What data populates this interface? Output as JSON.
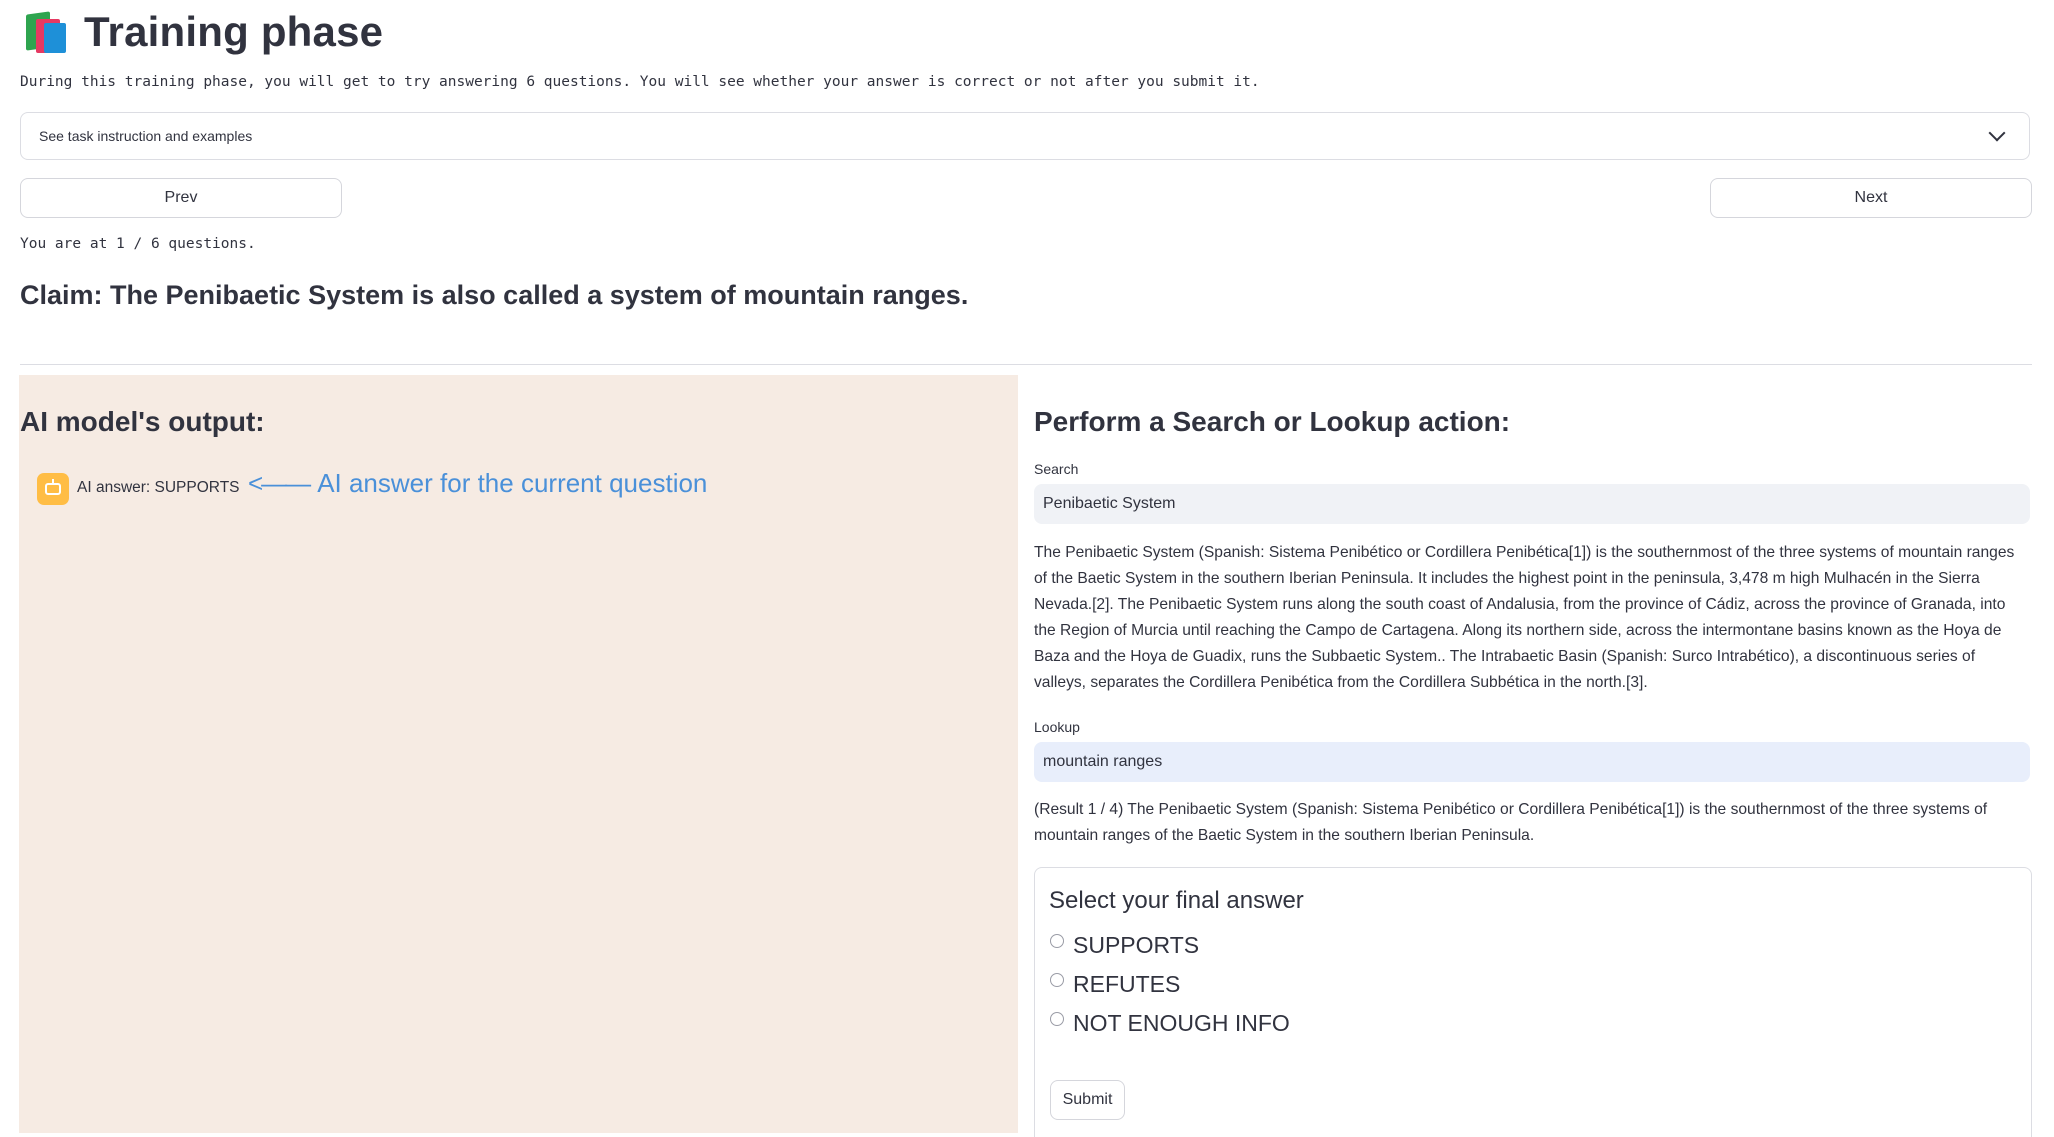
{
  "header": {
    "icon": "books-icon",
    "title": "Training phase"
  },
  "intro_text": "During this training phase, you will get to try answering 6 questions. You will see whether your answer is correct or not after you submit it.",
  "expander": {
    "label": "See task instruction and examples",
    "icon": "chevron-down-icon"
  },
  "navigation": {
    "prev_label": "Prev",
    "next_label": "Next",
    "progress_text": "You are at 1 / 6 questions."
  },
  "claim": "Claim: The Penibaetic System is also called a system of mountain ranges.",
  "left_panel": {
    "heading": "AI model's output:",
    "avatar_icon": "robot-icon",
    "ai_answer": "AI answer: SUPPORTS",
    "annotation_arrow": "<——",
    "annotation_text": "AI answer for the current question",
    "background": "#f6ebe3",
    "annotation_color": "#4a90d9"
  },
  "right_panel": {
    "heading": "Perform a Search or Lookup action:",
    "search": {
      "label": "Search",
      "value": "Penibaetic System",
      "result": "The Penibaetic System (Spanish: Sistema Penibético or Cordillera Penibética[1]) is the southernmost of the three systems of mountain ranges of the Baetic System in the southern Iberian Peninsula. It includes the highest point in the peninsula, 3,478 m high Mulhacén in the Sierra Nevada.[2]. The Penibaetic System runs along the south coast of Andalusia, from the province of Cádiz, across the province of Granada, into the Region of Murcia until reaching the Campo de Cartagena. Along its northern side, across the intermontane basins known as the Hoya de Baza and the Hoya de Guadix, runs the Subbaetic System.. The Intrabaetic Basin (Spanish: Surco Intrabético), a discontinuous series of valleys, separates the Cordillera Penibética from the Cordillera Subbética in the north.[3]."
    },
    "lookup": {
      "label": "Lookup",
      "value": "mountain ranges",
      "result": "(Result 1 / 4) The Penibaetic System (Spanish: Sistema Penibético or Cordillera Penibética[1]) is the southernmost of the three systems of mountain ranges of the Baetic System in the southern Iberian Peninsula."
    },
    "form": {
      "title": "Select your final answer",
      "options": [
        "SUPPORTS",
        "REFUTES",
        "NOT ENOUGH INFO"
      ],
      "submit_label": "Submit"
    }
  }
}
